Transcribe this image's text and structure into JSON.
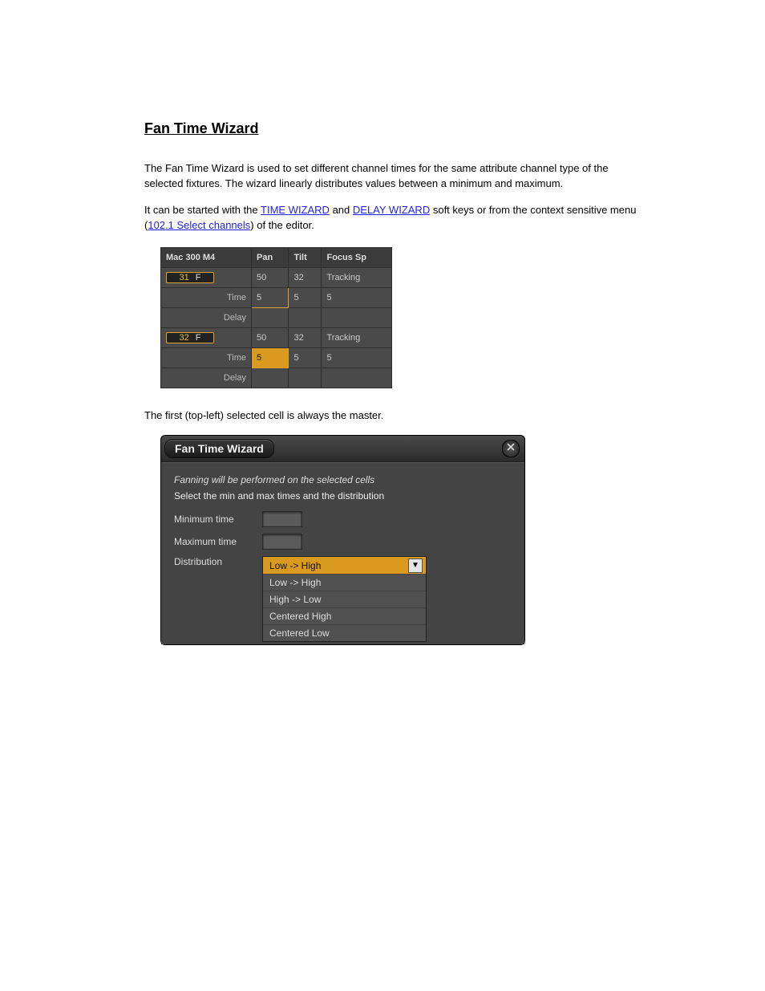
{
  "doc": {
    "heading": "Fan Time Wizard",
    "para1": "The Fan Time Wizard is used to set different channel times for the same attribute channel type of the selected fixtures. The wizard linearly distributes values between a minimum and maximum.",
    "para2_pre": "It can be started with the ",
    "link1": "TIME WIZARD",
    "para2_mid": " and ",
    "link2": "DELAY WIZARD",
    "para2_post": " soft keys or from the context sensitive menu (",
    "link3": "102.1 Select channels",
    "para2_tail": ") of the editor.",
    "para3": "The first (top-left) selected cell is always the master."
  },
  "grid": {
    "title": "Mac 300 M4",
    "cols": [
      "Pan",
      "Tilt",
      "Focus Sp"
    ],
    "row_labels": [
      "Time",
      "Delay"
    ],
    "rows": [
      {
        "id": "31",
        "flag": "F",
        "vals": [
          "50",
          "32",
          "Tracking"
        ],
        "time": [
          "5",
          "5",
          "5"
        ],
        "time_master": true,
        "time_sel": "outline"
      },
      {
        "id": "32",
        "flag": "F",
        "vals": [
          "50",
          "32",
          "Tracking"
        ],
        "time": [
          "5",
          "5",
          "5"
        ],
        "time_master": false,
        "time_sel": "fill"
      }
    ]
  },
  "wizard": {
    "title": "Fan Time Wizard",
    "note": "Fanning will be performed on the selected cells",
    "instr": "Select the min and max times and the distribution",
    "label_min": "Minimum time",
    "label_max": "Maximum time",
    "label_dist": "Distribution",
    "selected": "Low -> High",
    "options": [
      "Low -> High",
      "High -> Low",
      "Centered High",
      "Centered Low"
    ]
  }
}
